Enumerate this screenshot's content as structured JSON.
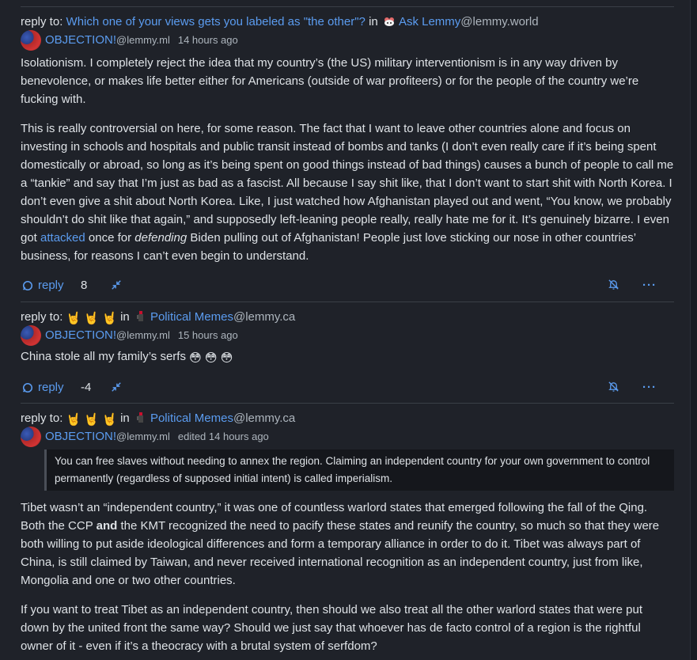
{
  "comments": [
    {
      "reply_prefix": "reply to:",
      "reply_title": "Which one of your views gets you labeled as \"the other\"?",
      "in_label": "in",
      "community_name": "Ask Lemmy",
      "community_instance": "@lemmy.world",
      "author_name": "OBJECTION!",
      "author_instance": "@lemmy.ml",
      "time": "14 hours ago",
      "paragraphs": [
        "Isolationism. I completely reject the idea that my country’s (the US) military interventionism is in any way driven by benevolence, or makes life better either for Americans (outside of war profiteers) or for the people of the country we’re fucking with."
      ],
      "p2_part1": "This is really controversial on here, for some reason. The fact that I want to leave other countries alone and focus on investing in schools and hospitals and public transit instead of bombs and tanks (I don’t even really care if it’s being spent domestically or abroad, so long as it’s being spent on good things instead of bad things) causes a bunch of people to call me a “tankie” and say that I’m just as bad as a fascist. All because I say shit like, that I don’t want to start shit with North Korea. I don’t even give a shit about North Korea. Like, I just watched how Afghanistan played out and went, “You know, we probably shouldn’t do shit like that again,” and supposedly left-leaning people really, really hate me for it. It’s genuinely bizarre. I even got ",
      "p2_link": "attacked",
      "p2_part2": " once for ",
      "p2_em": "defending",
      "p2_part3": " Biden pulling out of Afghanistan! People just love sticking our nose in other countries’ business, for reasons I can’t even begin to understand.",
      "reply_label": "reply",
      "score": "8",
      "more_label": "···"
    },
    {
      "reply_prefix": "reply to:",
      "reply_title_emoji": "🤘 🤘 🤘",
      "in_label": "in",
      "community_name": "Political Memes",
      "community_instance": "@lemmy.ca",
      "author_name": "OBJECTION!",
      "author_instance": "@lemmy.ml",
      "time": "15 hours ago",
      "body_text": "China stole all my family’s serfs",
      "body_emoji": "😳 😳 😳",
      "reply_label": "reply",
      "score": "-4",
      "more_label": "···"
    },
    {
      "reply_prefix": "reply to:",
      "reply_title_emoji": "🤘 🤘 🤘",
      "in_label": "in",
      "community_name": "Political Memes",
      "community_instance": "@lemmy.ca",
      "author_name": "OBJECTION!",
      "author_instance": "@lemmy.ml",
      "time": "edited 14 hours ago",
      "quote": "You can free slaves without needing to annex the region. Claiming an independent country for your own government to control permanently (regardless of supposed initial intent) is called imperialism.",
      "p1_part1": "Tibet wasn’t an “independent country,” it was one of countless warlord states that emerged following the fall of the Qing. Both the CCP ",
      "p1_bold": "and",
      "p1_part2": " the KMT recognized the need to pacify these states and reunify the country, so much so that they were both willing to put aside ideological differences and form a temporary alliance in order to do it. Tibet was always part of China, is still claimed by Taiwan, and never received international recognition as an independent country, just from like, Mongolia and one or two other countries.",
      "p2": "If you want to treat Tibet as an independent country, then should we also treat all the other warlord states that were put down by the united front the same way? Should we just say that whoever has de facto control of a region is the rightful owner of it - even if it’s a theocracy with a brutal system of serfdom?"
    }
  ],
  "colors": {
    "background": "#1f2229",
    "link": "#5b9cf0",
    "text": "#dee2e6",
    "muted": "#adb5bd",
    "divider": "#3a3f47"
  }
}
